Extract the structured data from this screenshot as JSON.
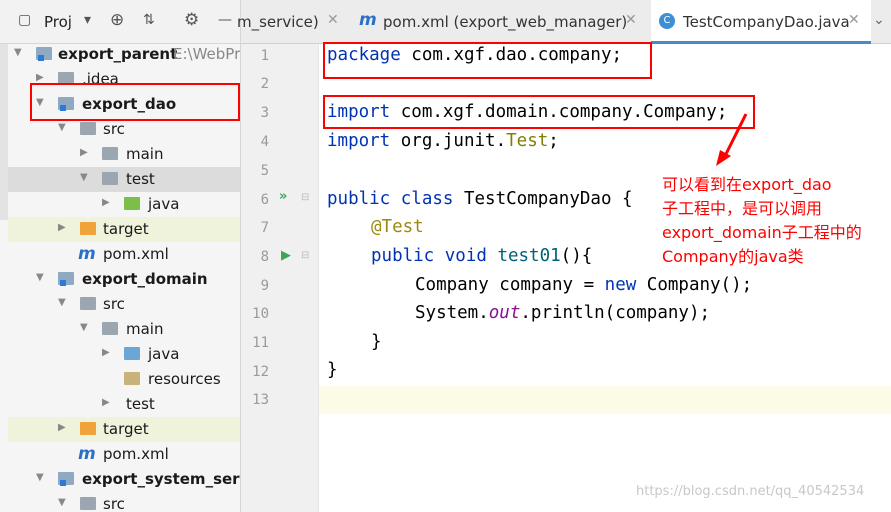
{
  "project_panel": {
    "title": "Proj",
    "tree": [
      {
        "label": "export_parent",
        "path": "E:\\WebPro",
        "type": "module",
        "bold": true
      },
      {
        "label": ".idea",
        "type": "folder"
      },
      {
        "label": "export_dao",
        "type": "module",
        "bold": true
      },
      {
        "label": "src",
        "type": "folder"
      },
      {
        "label": "main",
        "type": "folder"
      },
      {
        "label": "test",
        "type": "folder"
      },
      {
        "label": "java",
        "type": "folder-green"
      },
      {
        "label": "target",
        "type": "folder-orange"
      },
      {
        "label": "pom.xml",
        "type": "maven"
      },
      {
        "label": "export_domain",
        "type": "module",
        "bold": true
      },
      {
        "label": "src",
        "type": "folder"
      },
      {
        "label": "main",
        "type": "folder"
      },
      {
        "label": "java",
        "type": "folder-src"
      },
      {
        "label": "resources",
        "type": "folder-res"
      },
      {
        "label": "test",
        "type": "folder"
      },
      {
        "label": "target",
        "type": "folder-orange"
      },
      {
        "label": "pom.xml",
        "type": "maven"
      },
      {
        "label": "export_system_servic",
        "type": "module",
        "bold": true
      },
      {
        "label": "src",
        "type": "folder"
      }
    ]
  },
  "tabs": [
    {
      "label": "m_service)"
    },
    {
      "label": "pom.xml (export_web_manager)"
    },
    {
      "label": "TestCompanyDao.java",
      "active": true
    }
  ],
  "editor": {
    "lines": [
      "1",
      "2",
      "3",
      "4",
      "5",
      "6",
      "7",
      "8",
      "9",
      "10",
      "11",
      "12",
      "13"
    ],
    "code": {
      "l1_kw": "package",
      "l1_rest": " com.xgf.dao.company;",
      "l3_kw": "import",
      "l3_rest": " com.xgf.domain.company.Company;",
      "l4_kw": "import",
      "l4_rest": " org.junit.",
      "l4_cls": "Test",
      "l4_end": ";",
      "l6_kw": "public class",
      "l6_rest": " TestCompanyDao {",
      "l7_ann": "@Test",
      "l8_kw": "public void",
      "l8_meth": " test01",
      "l8_rest": "(){",
      "l9_a": "Company company = ",
      "l9_kw": "new",
      "l9_b": " Company();",
      "l10_a": "System.",
      "l10_field": "out",
      "l10_b": ".println(company);",
      "l11": "}",
      "l12": "}"
    }
  },
  "annotation": {
    "line1": "可以看到在export_dao",
    "line2": "子工程中，是可以调用",
    "line3": "export_domain子工程中的",
    "line4": "Company的java类"
  },
  "watermark": "https://blog.csdn.net/qq_40542534",
  "colors": {
    "annotation": "#ff0000",
    "keyword": "#0033b3"
  }
}
